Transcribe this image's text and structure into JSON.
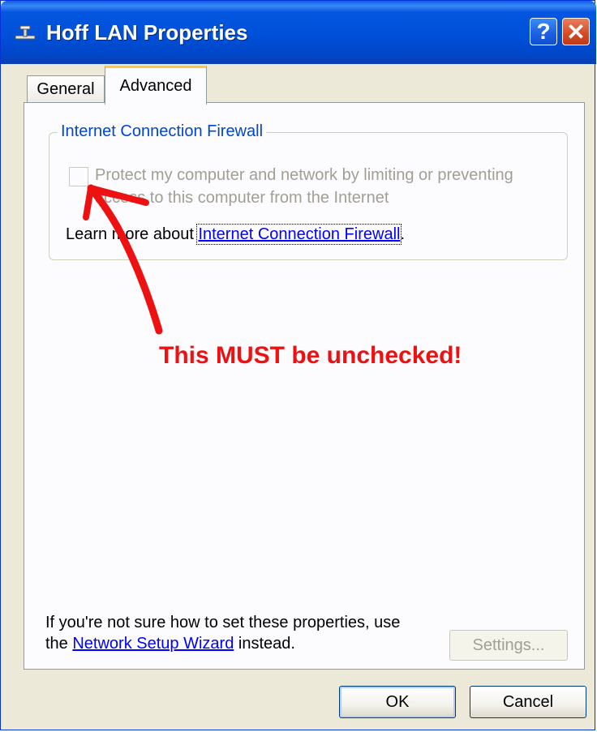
{
  "window": {
    "title": "Hoff LAN Properties",
    "help_glyph": "?",
    "close_glyph": "✕"
  },
  "tabs": [
    {
      "label": "General",
      "active": false
    },
    {
      "label": "Advanced",
      "active": true
    }
  ],
  "firewall_group": {
    "legend": "Internet Connection Firewall",
    "checkbox_checked": false,
    "checkbox_enabled": false,
    "checkbox_label": "Protect my computer and network by limiting or preventing access to this computer from the Internet",
    "learn_prefix": "Learn more about ",
    "learn_link": "Internet Connection Firewall",
    "learn_suffix": "."
  },
  "annotation": {
    "text": "This MUST be unchecked!",
    "color": "#EE1111"
  },
  "wizard": {
    "line_prefix": "If you're not sure how to set these properties, use the ",
    "link": "Network Setup Wizard",
    "line_suffix": " instead."
  },
  "buttons": {
    "settings": "Settings...",
    "ok": "OK",
    "cancel": "Cancel"
  },
  "colors": {
    "titlebar": "#0054E3",
    "dialog_bg": "#ECE9D8",
    "group_legend": "#0046D5",
    "link": "#0000FF",
    "disabled_text": "#A19F92"
  },
  "icons": {
    "title_icon": "network-connection-icon",
    "help": "help-icon",
    "close": "close-icon"
  }
}
